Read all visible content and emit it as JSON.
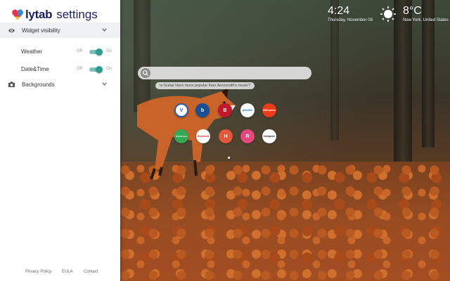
{
  "sidebar": {
    "brand": "lytab",
    "title": "settings",
    "sections": {
      "widget_visibility": "Widget visibility",
      "backgrounds": "Backgrounds"
    },
    "toggles": [
      {
        "label": "Weather",
        "off": "Off",
        "on": "On",
        "enabled": true
      },
      {
        "label": "Date&Time",
        "off": "Off",
        "on": "On",
        "enabled": true
      }
    ],
    "footer": {
      "privacy": "Privacy Policy",
      "eula": "EULA",
      "contact": "Contact"
    }
  },
  "widgets": {
    "time": "4:24",
    "date": "Thursday, November 08",
    "temperature": "8°C",
    "location": "New York, United States"
  },
  "search": {
    "placeholder": "",
    "suggestion": "Is Guitar Hero more popular than Aerosmith's music?"
  },
  "tiles": [
    {
      "label": "V",
      "color": "#2a5fb0"
    },
    {
      "label": "b",
      "color": "#1b4f8f"
    },
    {
      "label": "B",
      "color": "#c0182a"
    },
    {
      "label": "priceline",
      "color": "#0a58c6"
    },
    {
      "label": "AliExpress",
      "color": "#e93c1a"
    },
    {
      "label": "TripAdvisor",
      "color": "#34a852"
    },
    {
      "label": "Overstock",
      "color": "#c01c28"
    },
    {
      "label": "H",
      "color": "#e3583b"
    },
    {
      "label": "R",
      "color": "#e24a7d"
    },
    {
      "label": "Instagram",
      "color": "#333333"
    }
  ],
  "colors": {
    "accent": "#2a9d8f",
    "brand": "#1a1f5c"
  }
}
